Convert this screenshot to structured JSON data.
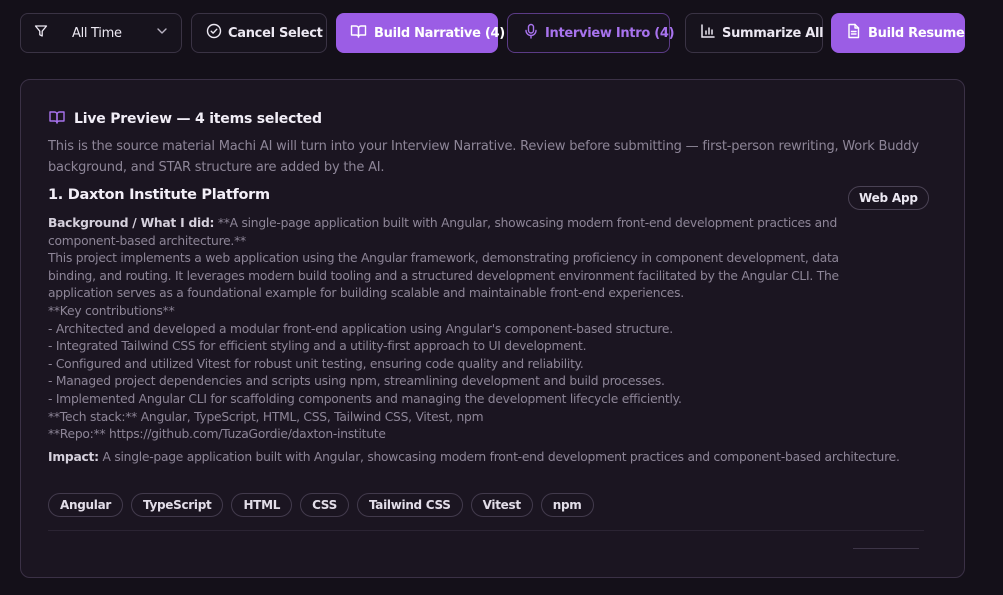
{
  "toolbar": {
    "filter": {
      "icon": "funnel-icon",
      "value": "All Time",
      "chevron": "chevron-down-icon"
    },
    "cancel_select": {
      "icon": "check-circle-icon",
      "label": "Cancel Select"
    },
    "build_narrative": {
      "icon": "book-open-icon",
      "label": "Build Narrative (4)"
    },
    "interview_intro": {
      "icon": "microphone-icon",
      "label": "Interview Intro (4)"
    },
    "summarize_all": {
      "icon": "bar-chart-icon",
      "label": "Summarize All"
    },
    "build_resume": {
      "icon": "document-icon",
      "label": "Build Resume"
    }
  },
  "preview": {
    "icon": "book-open-icon",
    "title": "Live Preview — 4 items selected",
    "description": "This is the source material Machi AI will turn into your Interview Narrative. Review before submitting — first-person rewriting, Work Buddy background, and STAR structure are added by the AI.",
    "item": {
      "title": "1. Daxton Institute Platform",
      "badge": "Web App",
      "background_label": "Background / What I did:",
      "background_lines": [
        "**A single-page application built with Angular, showcasing modern front-end development practices and",
        "component-based architecture.**",
        "This project implements a web application using the Angular framework, demonstrating proficiency in component development, data",
        "binding, and routing. It leverages modern build tooling and a structured development environment facilitated by the Angular CLI. The",
        "application serves as a foundational example for building scalable and maintainable front-end experiences.",
        "**Key contributions**",
        "- Architected and developed a modular front-end application using Angular's component-based structure.",
        "- Integrated Tailwind CSS for efficient styling and a utility-first approach to UI development.",
        "- Configured and utilized Vitest for robust unit testing, ensuring code quality and reliability.",
        "- Managed project dependencies and scripts using npm, streamlining development and build processes.",
        "- Implemented Angular CLI for scaffolding components and managing the development lifecycle efficiently.",
        "**Tech stack:** Angular, TypeScript, HTML, CSS, Tailwind CSS, Vitest, npm",
        "**Repo:** https://github.com/TuzaGordie/daxton-institute"
      ],
      "impact_label": "Impact:",
      "impact_text": "A single-page application built with Angular, showcasing modern front-end development practices and component-based architecture.",
      "tags": [
        "Angular",
        "TypeScript",
        "HTML",
        "CSS",
        "Tailwind CSS",
        "Vitest",
        "npm"
      ]
    }
  },
  "colors": {
    "background": "#141019",
    "card": "#1b1521",
    "accent": "#9b5de5",
    "accent_text": "#a873ee"
  }
}
